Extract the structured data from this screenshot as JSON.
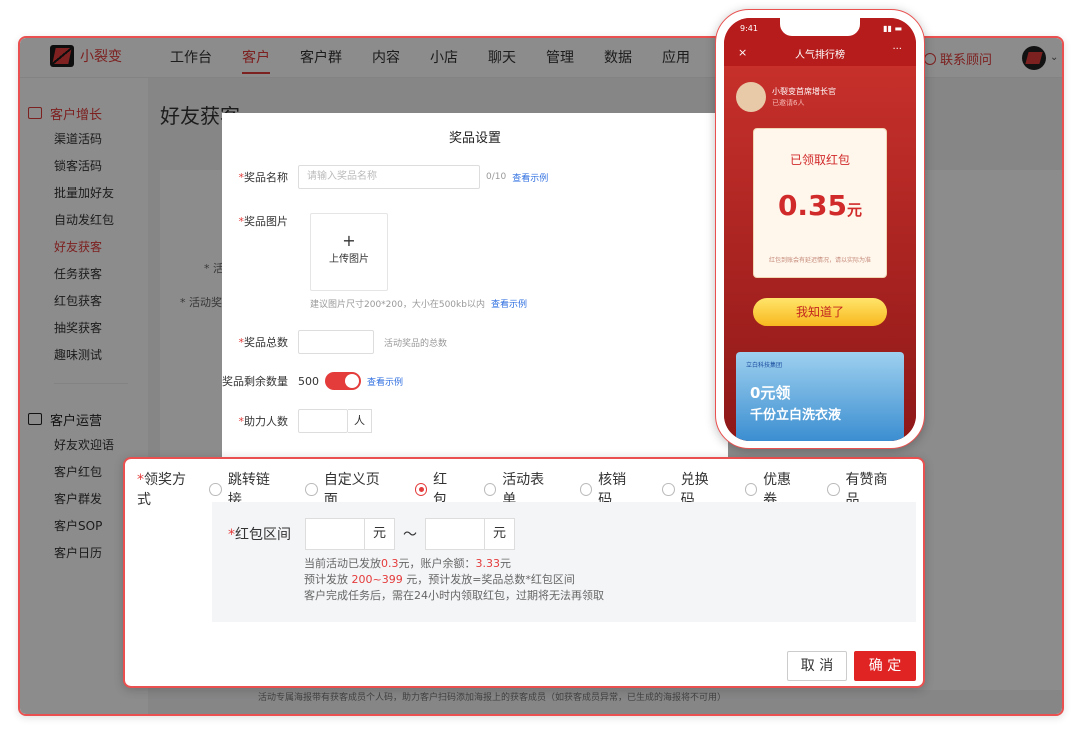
{
  "app": {
    "logo_text": "小裂变",
    "nav": [
      "工作台",
      "客户",
      "客户群",
      "内容",
      "小店",
      "聊天",
      "管理",
      "数据",
      "应用"
    ],
    "consult": "联系顾问"
  },
  "sidebar": {
    "sec1": "客户增长",
    "items1": [
      "渠道活码",
      "锁客活码",
      "批量加好友",
      "自动发红包",
      "好友获客",
      "任务获客",
      "红包获客",
      "抽奖获客",
      "趣味测试"
    ],
    "sec2": "客户运营",
    "items2": [
      "好友欢迎语",
      "客户红包",
      "客户群发",
      "客户SOP",
      "客户日历"
    ]
  },
  "page": {
    "title": "好友获客",
    "label1": "* 活",
    "label2": "* 活动奖品",
    "bottom_note": "活动专属海报带有获客成员个人码，助力客户扫码添加海报上的获客成员（如获客成员异常，已生成的海报将不可用）"
  },
  "dialog": {
    "title": "奖品设置",
    "name_label": "奖品名称",
    "name_placeholder": "请输入奖品名称",
    "name_count": "0/10",
    "example": "查看示例",
    "image_label": "奖品图片",
    "upload_plus": "+",
    "upload_text": "上传图片",
    "image_hint": "建议图片尺寸200*200，大小在500kb以内",
    "total_label": "奖品总数",
    "total_hint": "活动奖品的总数",
    "remain_label": "奖品剩余数量",
    "remain_value": "500",
    "help_label": "助力人数",
    "help_unit": "人"
  },
  "panel": {
    "method_label": "领奖方式",
    "options": [
      "跳转链接",
      "自定义页面",
      "红包",
      "活动表单",
      "核销码",
      "兑换码",
      "优惠券",
      "有赞商品"
    ],
    "selected_index": 2,
    "range_label": "红包区间",
    "unit": "元",
    "tilde": "～",
    "note1_a": "当前活动已发放",
    "note1_b": "0.3",
    "note1_c": "元，账户余额：",
    "note1_d": "3.33",
    "note1_e": "元",
    "note2_a": "预计发放 ",
    "note2_b": "200~399",
    "note2_c": " 元，预计发放=奖品总数*红包区间",
    "note3": "客户完成任务后，需在24小时内领取红包，过期将无法再领取",
    "cancel": "取 消",
    "ok": "确 定"
  },
  "phone": {
    "time": "9:41",
    "title": "人气排行榜",
    "close": "×",
    "more": "···",
    "user_name": "小裂变首席增长官",
    "user_sub": "已邀请6人",
    "env_head": "已领取红包",
    "amount": "0.35",
    "amount_unit": "元",
    "env_note": "红包到账会有延迟情况，请以实际为准",
    "env_btn": "我知道了",
    "promo_brand": "立白科技集团",
    "promo_title": "0元领",
    "promo_sub": "千份立白洗衣液"
  },
  "colors": {
    "brand": "#e43b3b",
    "link": "#2f6fe0"
  }
}
